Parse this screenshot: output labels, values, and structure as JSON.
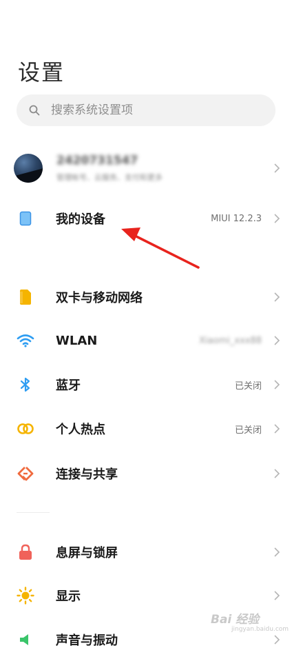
{
  "header": {
    "title": "设置"
  },
  "search": {
    "placeholder": "搜索系统设置项"
  },
  "account": {
    "id": "2420731547",
    "subtitle": "管理帐号、云服务、支付和更多"
  },
  "items": [
    {
      "label": "我的设备",
      "value": "MIUI 12.2.3",
      "icon": "device-icon"
    },
    {
      "label": "双卡与移动网络",
      "value": "",
      "icon": "sim-card-icon"
    },
    {
      "label": "WLAN",
      "value": "Xiaomi_xxx88",
      "icon": "wifi-icon"
    },
    {
      "label": "蓝牙",
      "value": "已关闭",
      "icon": "bluetooth-icon"
    },
    {
      "label": "个人热点",
      "value": "已关闭",
      "icon": "hotspot-icon"
    },
    {
      "label": "连接与共享",
      "value": "",
      "icon": "connection-share-icon"
    },
    {
      "label": "息屏与锁屏",
      "value": "",
      "icon": "lock-icon"
    },
    {
      "label": "显示",
      "value": "",
      "icon": "brightness-icon"
    },
    {
      "label": "声音与振动",
      "value": "",
      "icon": "sound-icon"
    }
  ],
  "watermark": {
    "text": "Bai 经验",
    "url": "jingyan.baidu.com"
  },
  "colors": {
    "device": "#4aa3f0",
    "sim": "#f5b400",
    "wifi": "#2e9df2",
    "bluetooth": "#2e9df2",
    "hotspot": "#f5b400",
    "connection": "#f06a3e",
    "lock": "#f0625a",
    "display": "#f5b400",
    "sound": "#3ac46a",
    "arrow": "#e8231d"
  }
}
